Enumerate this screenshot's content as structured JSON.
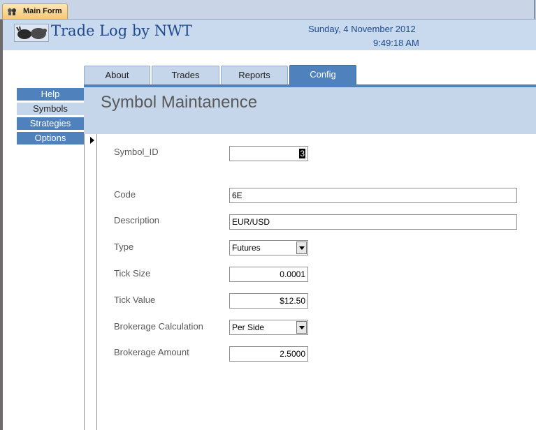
{
  "document_tab": {
    "label": "Main Form",
    "icon": "gear-icon"
  },
  "header": {
    "title": "Trade Log by NWT",
    "logo": "bull-bear-logo",
    "date": "Sunday, 4 November 2012",
    "time": "9:49:18 AM"
  },
  "tabs": [
    {
      "label": "About"
    },
    {
      "label": "Trades"
    },
    {
      "label": "Reports"
    },
    {
      "label": "Config",
      "active": true
    }
  ],
  "nav": [
    {
      "label": "Help"
    },
    {
      "label": "Symbols",
      "selected": true
    },
    {
      "label": "Strategies"
    },
    {
      "label": "Options"
    }
  ],
  "form": {
    "title": "Symbol Maintanence",
    "fields": [
      {
        "label": "Symbol_ID",
        "value": "3"
      },
      {
        "label": "Code",
        "value": "6E"
      },
      {
        "label": "Description",
        "value": "EUR/USD"
      },
      {
        "label": "Type",
        "value": "Futures"
      },
      {
        "label": "Tick Size",
        "value": "0.0001"
      },
      {
        "label": "Tick Value",
        "value": "$12.50"
      },
      {
        "label": "Brokerage Calculation",
        "value": "Per Side"
      },
      {
        "label": "Brokerage Amount",
        "value": "2.5000"
      }
    ]
  },
  "colors": {
    "accent": "#4f81bd",
    "header_bg": "#c9d9ee",
    "tab_bg": "#c5d6ea",
    "title_text": "#1f4a8c"
  }
}
